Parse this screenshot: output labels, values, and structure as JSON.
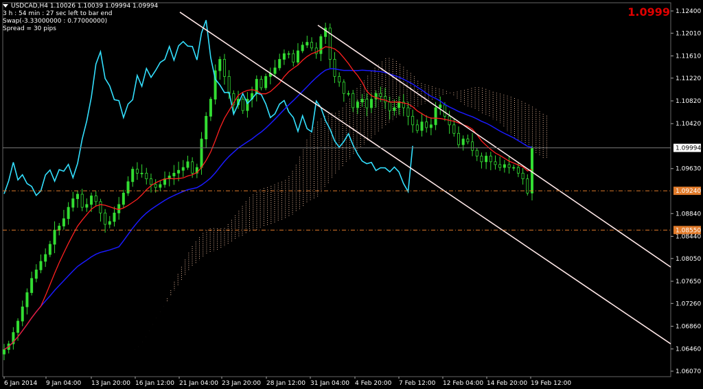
{
  "header": {
    "symbol_line": "USDCAD,H4  1.10026 1.10039 1.09994 1.09994",
    "timer": "3 h : 54 min : 27 sec left to bar end",
    "swap": "Swap(-3.33000000 : 0.77000000)",
    "spread": "Spread = 30 pips",
    "big_price": "1.0999"
  },
  "colors": {
    "background": "#000000",
    "bull_candle": "#33dd33",
    "tenkan": "#ff2020",
    "kijun": "#1a1aff",
    "chikou": "#33e0ff",
    "cloud": "#e8b89a",
    "channel": "#ffe8e8",
    "level_line": "#e07a2a",
    "big_price": "#e00000"
  },
  "chart_data": {
    "type": "candlestick",
    "symbol": "USDCAD",
    "timeframe": "H4",
    "current_price": 1.09994,
    "ylim": [
      1.0607,
      1.124
    ],
    "y_ticks": [
      "1.12400",
      "1.12010",
      "1.11610",
      "1.11220",
      "1.10820",
      "1.10420",
      "1.09630",
      "1.08840",
      "1.08440",
      "1.08050",
      "1.07650",
      "1.07260",
      "1.06860",
      "1.06460",
      "1.06070"
    ],
    "x_ticks": [
      "6 Jan 2014",
      "9 Jan 04:00",
      "13 Jan 20:00",
      "16 Jan 12:00",
      "21 Jan 04:00",
      "23 Jan 20:00",
      "28 Jan 12:00",
      "31 Jan 04:00",
      "4 Feb 20:00",
      "7 Feb 12:00",
      "12 Feb 04:00",
      "14 Feb 20:00",
      "19 Feb 12:00"
    ],
    "price_badges": [
      {
        "label": "1.09994",
        "value": 1.09994,
        "style": "current"
      },
      {
        "label": "1.09240",
        "value": 1.0924,
        "style": "level"
      },
      {
        "label": "1.08550",
        "value": 1.0855,
        "style": "level"
      }
    ],
    "close_series": [
      1.0645,
      1.0655,
      1.0675,
      1.0695,
      1.072,
      1.0745,
      1.077,
      1.0785,
      1.08,
      1.0812,
      1.083,
      1.0855,
      1.0862,
      1.0875,
      1.0895,
      1.091,
      1.0918,
      1.0895,
      1.09,
      1.0915,
      1.0905,
      1.0885,
      1.0865,
      1.087,
      1.0885,
      1.09,
      1.092,
      1.094,
      1.0962,
      1.0955,
      1.0955,
      1.0945,
      1.0935,
      1.093,
      1.0935,
      1.0945,
      1.095,
      1.0955,
      1.096,
      1.0965,
      1.0975,
      1.0955,
      1.0965,
      1.1015,
      1.1055,
      1.1085,
      1.1135,
      1.1155,
      1.1125,
      1.1095,
      1.1075,
      1.1085,
      1.1065,
      1.1085,
      1.1095,
      1.112,
      1.1105,
      1.1125,
      1.113,
      1.114,
      1.1155,
      1.1165,
      1.1165,
      1.115,
      1.117,
      1.118,
      1.1185,
      1.1175,
      1.1165,
      1.1195,
      1.121,
      1.1155,
      1.1125,
      1.1115,
      1.1095,
      1.1095,
      1.107,
      1.108,
      1.1085,
      1.107,
      1.1085,
      1.1095,
      1.109,
      1.108,
      1.1065,
      1.107,
      1.108,
      1.107,
      1.1055,
      1.104,
      1.103,
      1.1045,
      1.1035,
      1.104,
      1.107,
      1.1075,
      1.1055,
      1.104,
      1.1025,
      1.1005,
      1.1015,
      1.101,
      1.0995,
      1.0985,
      1.0975,
      1.0985,
      1.0975,
      1.097,
      1.0965,
      1.097,
      1.0965,
      1.0965,
      1.0955,
      1.0945,
      1.092,
      1.0998
    ],
    "channel_lines": [
      {
        "from": [
          "6 Jan 2014",
          ""
        ],
        "label": ""
      }
    ],
    "horizontal_levels": [
      1.0924,
      1.0855
    ],
    "indicators": [
      "Ichimoku Tenkan-sen",
      "Ichimoku Kijun-sen",
      "Ichimoku Chikou span",
      "Ichimoku cloud"
    ]
  }
}
